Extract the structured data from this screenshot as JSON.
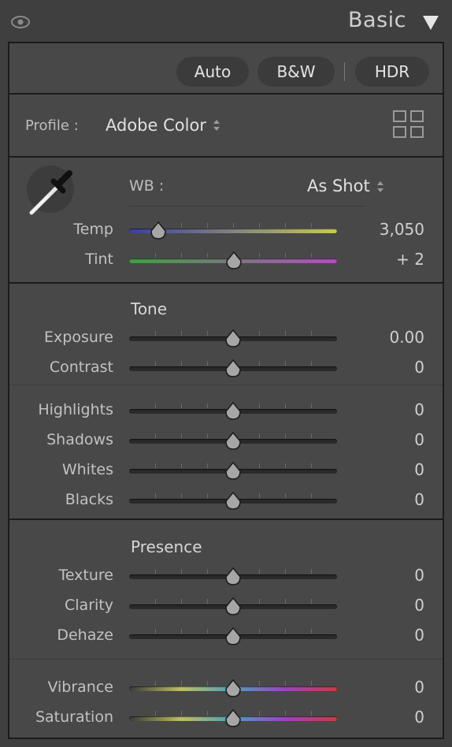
{
  "header": {
    "title": "Basic",
    "eye_icon": "eye-icon",
    "collapse_icon": "triangle-down-icon"
  },
  "treatment": {
    "auto": "Auto",
    "bw": "B&W",
    "hdr": "HDR"
  },
  "profile": {
    "label": "Profile :",
    "value": "Adobe Color",
    "browser_icon": "grid-icon"
  },
  "wb": {
    "picker_icon": "eyedropper-icon",
    "label": "WB :",
    "value": "As Shot"
  },
  "sliders_wb": [
    {
      "label": "Temp",
      "value": "3,050",
      "position": 0.14,
      "track": "temp"
    },
    {
      "label": "Tint",
      "value": "+ 2",
      "position": 0.505,
      "track": "tint"
    }
  ],
  "tone": {
    "title": "Tone",
    "sliders_a": [
      {
        "label": "Exposure",
        "value": "0.00",
        "position": 0.5
      },
      {
        "label": "Contrast",
        "value": "0",
        "position": 0.5
      }
    ],
    "sliders_b": [
      {
        "label": "Highlights",
        "value": "0",
        "position": 0.5
      },
      {
        "label": "Shadows",
        "value": "0",
        "position": 0.5
      },
      {
        "label": "Whites",
        "value": "0",
        "position": 0.5
      },
      {
        "label": "Blacks",
        "value": "0",
        "position": 0.5
      }
    ]
  },
  "presence": {
    "title": "Presence",
    "sliders_a": [
      {
        "label": "Texture",
        "value": "0",
        "position": 0.5
      },
      {
        "label": "Clarity",
        "value": "0",
        "position": 0.5
      },
      {
        "label": "Dehaze",
        "value": "0",
        "position": 0.5
      }
    ],
    "sliders_b": [
      {
        "label": "Vibrance",
        "value": "0",
        "position": 0.5,
        "track": "color"
      },
      {
        "label": "Saturation",
        "value": "0",
        "position": 0.5,
        "track": "color"
      }
    ]
  },
  "colors": {
    "panel": "#484848",
    "border": "#1b1b1b",
    "temp_gradient": [
      "#3a3fa0",
      "#c9c95a"
    ],
    "tint_gradient": [
      "#3fa03f",
      "#b44cc0"
    ],
    "color_gradient": [
      "#3a3a3a",
      "#c0c060",
      "#4aa0c0",
      "#a040c0",
      "#c04040"
    ]
  }
}
